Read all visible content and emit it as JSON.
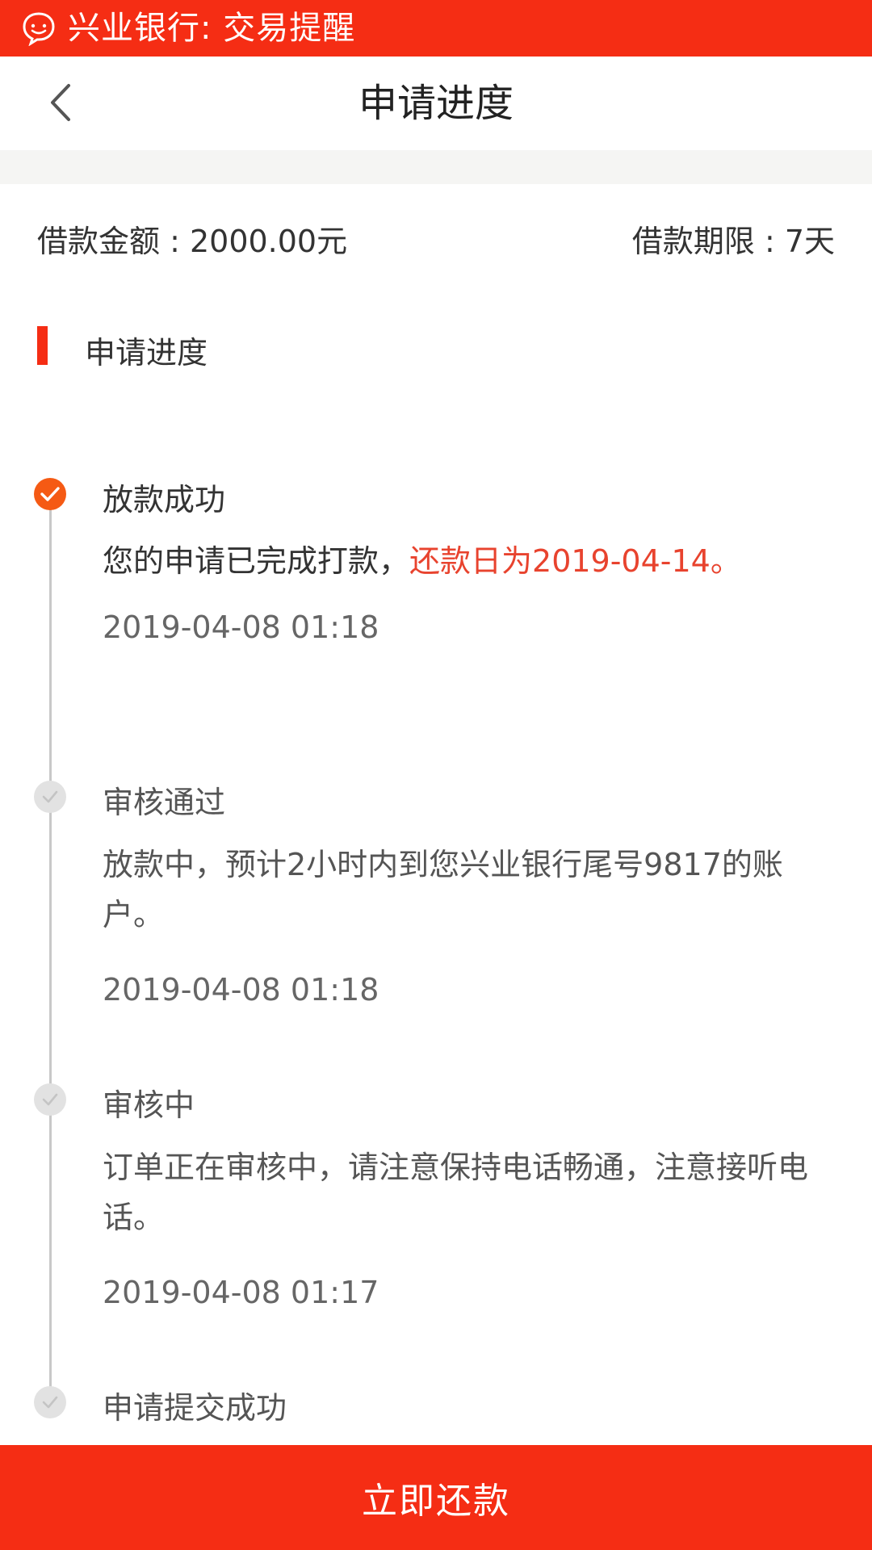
{
  "notification": {
    "icon": "chat-bubble-icon",
    "text": "兴业银行: 交易提醒"
  },
  "header": {
    "back_icon": "chevron-left-icon",
    "title": "申请进度"
  },
  "loan": {
    "amount_text": "借款金额 : 2000.00元",
    "term_text": "借款期限 : 7天"
  },
  "section": {
    "title": "申请进度"
  },
  "timeline": {
    "steps": [
      {
        "title": "放款成功",
        "desc_prefix": "您的申请已完成打款，",
        "desc_highlight": "还款日为2019-04-14。",
        "time": "2019-04-08 01:18",
        "status": "active"
      },
      {
        "title": "审核通过",
        "desc": "放款中，预计2小时内到您兴业银行尾号9817的账户。",
        "time": "2019-04-08 01:18",
        "status": "done"
      },
      {
        "title": "审核中",
        "desc": "订单正在审核中，请注意保持电话畅通，注意接听电话。",
        "time": "2019-04-08 01:17",
        "status": "done"
      },
      {
        "title": "申请提交成功",
        "status": "done"
      }
    ]
  },
  "footer": {
    "button_label": "立即还款"
  },
  "colors": {
    "brand_red": "#f52d14",
    "active_dot": "#f55a14",
    "highlight_text": "#e8432e",
    "inactive_dot": "#e2e2e2"
  }
}
